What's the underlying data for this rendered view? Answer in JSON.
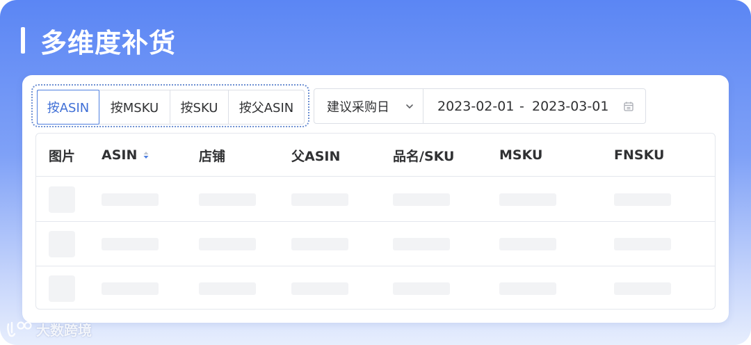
{
  "header": {
    "title": "多维度补货"
  },
  "filters": {
    "segments": [
      {
        "label": "按ASIN",
        "active": true
      },
      {
        "label": "按MSKU",
        "active": false
      },
      {
        "label": "按SKU",
        "active": false
      },
      {
        "label": "按父ASIN",
        "active": false
      }
    ],
    "date_type_select": {
      "value": "建议采购日",
      "icon": "chevron-down-icon"
    },
    "date_range": {
      "start": "2023-02-01",
      "separator": "-",
      "end": "2023-03-01",
      "icon": "calendar-icon"
    }
  },
  "table": {
    "columns": [
      {
        "label": "图片"
      },
      {
        "label": "ASIN",
        "sortable": true
      },
      {
        "label": "店铺"
      },
      {
        "label": "父ASIN"
      },
      {
        "label": "品名/SKU"
      },
      {
        "label": "MSKU"
      },
      {
        "label": "FNSKU"
      }
    ],
    "loading_rows": 3
  },
  "watermark": {
    "text": "大数跨境"
  },
  "colors": {
    "accent": "#3f6fd6",
    "border": "#dcdfe6",
    "skeleton": "#f2f3f5"
  }
}
